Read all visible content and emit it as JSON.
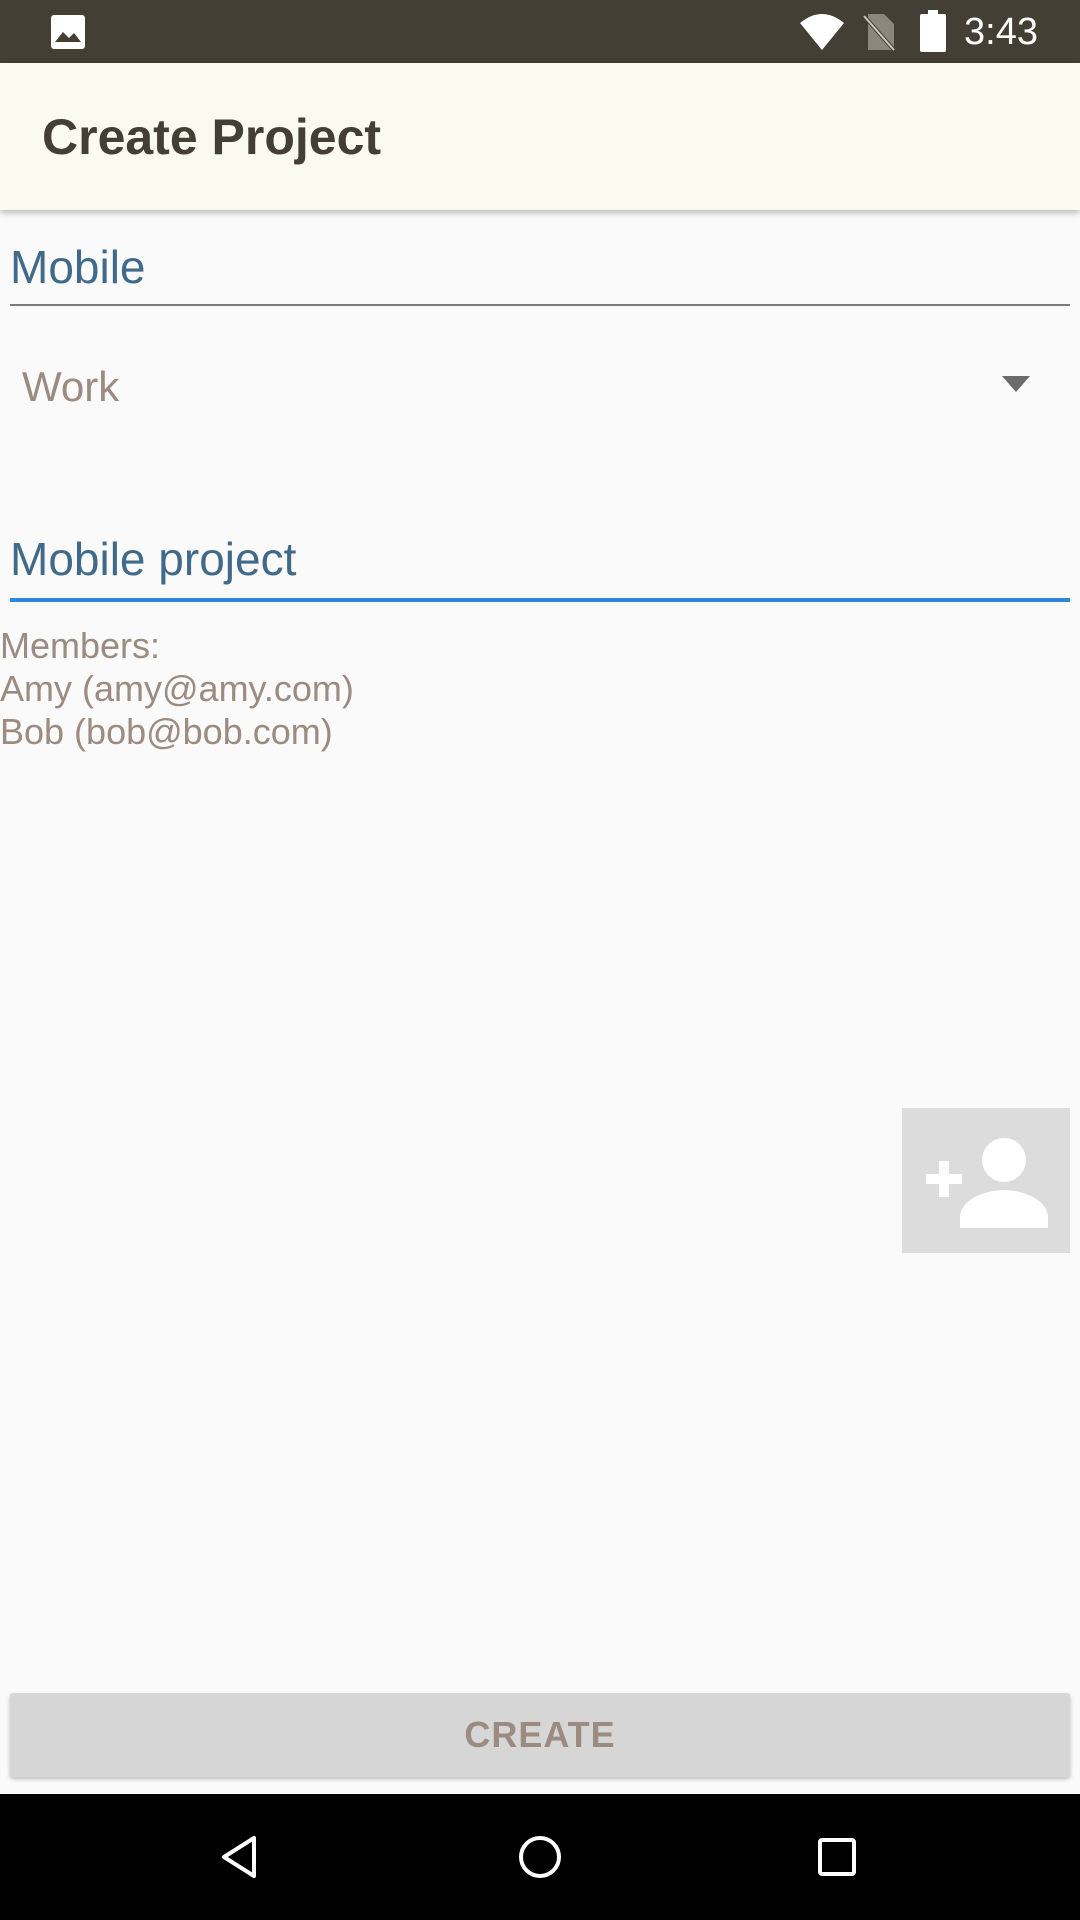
{
  "status_bar": {
    "time": "3:43",
    "icons": [
      "gallery-icon",
      "wifi-icon",
      "no-sim-icon",
      "battery-icon"
    ]
  },
  "app_bar": {
    "title": "Create Project"
  },
  "form": {
    "project_name": "Mobile",
    "category": "Work",
    "description": "Mobile project"
  },
  "members": {
    "heading": "Members:",
    "list": [
      "Amy (amy@amy.com)",
      "Bob (bob@bob.com)"
    ]
  },
  "add_member": {
    "icon": "add-person-icon"
  },
  "create_button": {
    "label": "CREATE"
  },
  "nav_bar": {
    "icons": [
      "back-icon",
      "home-icon",
      "recents-icon"
    ]
  },
  "colors": {
    "status_bar": "#443f35",
    "app_bar": "#fafaf0",
    "field_text": "#416a8a",
    "secondary_text": "#9b8b80",
    "focus_underline": "#2d86d8",
    "button_bg": "#d6d6d6"
  }
}
